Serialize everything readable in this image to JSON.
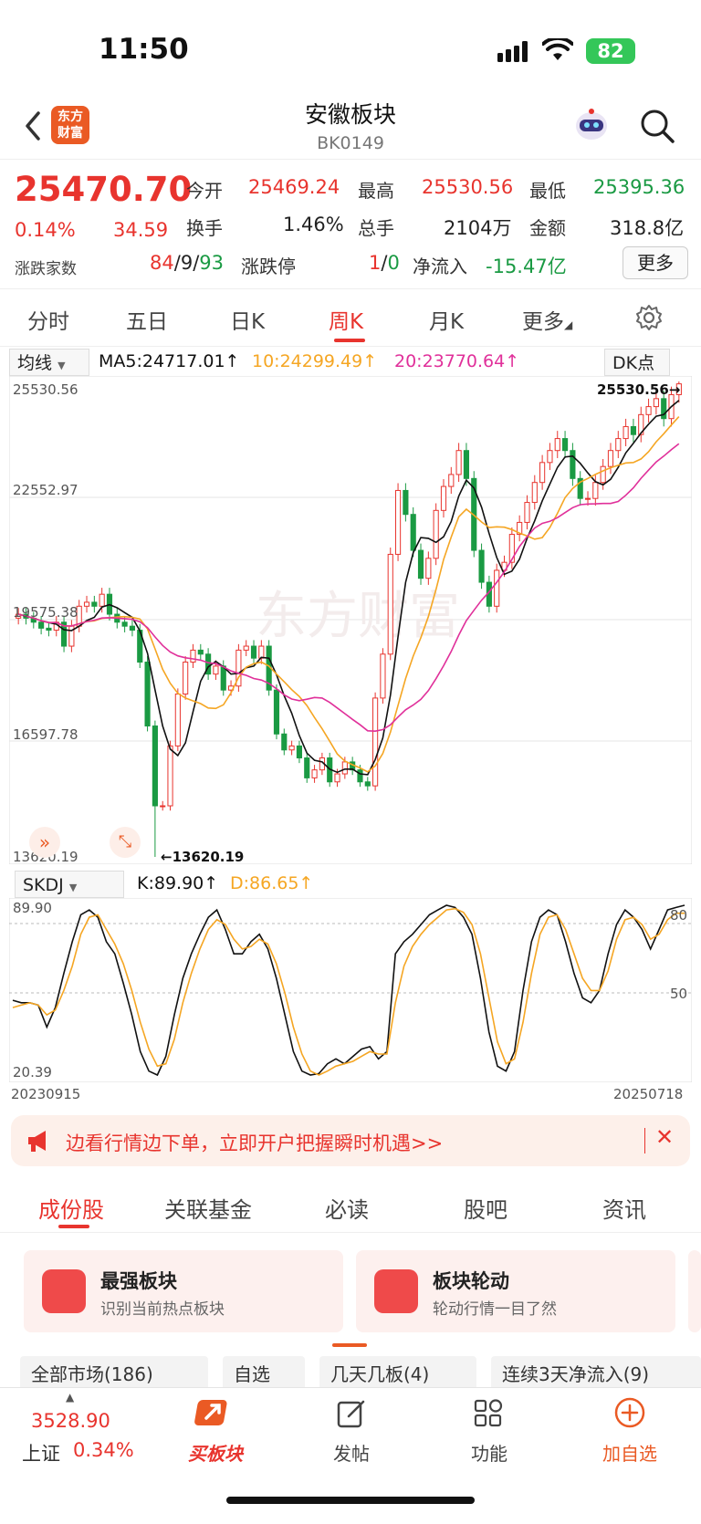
{
  "status_bar": {
    "time": "11:50",
    "battery": "82"
  },
  "header": {
    "title": "安徽板块",
    "code": "BK0149",
    "logo_text_1": "东方",
    "logo_text_2": "财富"
  },
  "quote": {
    "price": "25470.70",
    "change_pct": "0.14%",
    "change": "34.59",
    "open_label": "今开",
    "open": "25469.24",
    "high_label": "最高",
    "high": "25530.56",
    "low_label": "最低",
    "low": "25395.36",
    "turnover_label": "换手",
    "turnover": "1.46%",
    "volume_label": "总手",
    "volume": "2104万",
    "amount_label": "金额",
    "amount": "318.8亿",
    "breadth_label": "涨跌家数",
    "up": "84",
    "flat": "9",
    "down": "93",
    "limit_label": "涨跌停",
    "limit_up": "1",
    "limit_down": "0",
    "netflow_label": "净流入",
    "netflow": "-15.47亿",
    "more_label": "更多",
    "sep": "/"
  },
  "period_tabs": [
    "分时",
    "五日",
    "日K",
    "周K",
    "月K",
    "更多"
  ],
  "active_tab": "周K",
  "ma_bar": {
    "select": "均线",
    "ma5": "MA5:24717.01↑",
    "ma10": "10:24299.49↑",
    "ma20": "20:23770.64↑",
    "dk": "DK点"
  },
  "price_axis": {
    "top": "25530.56",
    "mid1": "22552.97",
    "mid2": "19575.38",
    "mid3": "16597.78",
    "bottom": "13620.19",
    "max_label": "25530.56→",
    "min_label": "←13620.19"
  },
  "watermark": "东方财富",
  "indicator_bar": {
    "select": "SKDJ",
    "k": "K:89.90↑",
    "d": "D:86.65↑"
  },
  "indicator_axis": {
    "top": "89.90",
    "bottom": "20.39",
    "l80": "80",
    "l50": "50"
  },
  "date_axis": {
    "start": "20230915",
    "end": "20250718"
  },
  "colors": {
    "up": "#e8342e",
    "down": "#1a9a43",
    "ma5": "#111111",
    "ma10": "#f5a623",
    "ma20": "#e0309a",
    "accent": "#ea5a24"
  },
  "chart_data": {
    "type": "candlestick",
    "title": "",
    "period": "weekly",
    "ylim": [
      13620.19,
      25530.56
    ],
    "max_high": 25530.56,
    "min_low": 13620.19,
    "closes": [
      19700,
      19600,
      19500,
      19350,
      19300,
      19500,
      18900,
      19400,
      19900,
      20000,
      19900,
      20200,
      19700,
      19500,
      19400,
      19300,
      18500,
      16900,
      14900,
      14900,
      16400,
      17700,
      18500,
      18800,
      18700,
      18200,
      18400,
      17800,
      17900,
      18800,
      18900,
      18600,
      18900,
      17800,
      16700,
      16300,
      16400,
      16100,
      15600,
      15800,
      16100,
      15500,
      15700,
      16000,
      15800,
      15500,
      15400,
      17600,
      18700,
      21200,
      22800,
      22200,
      21300,
      20600,
      21100,
      22300,
      22900,
      23200,
      23800,
      23100,
      21300,
      20500,
      19900,
      20800,
      21000,
      21700,
      22000,
      22500,
      23000,
      23500,
      23800,
      24100,
      23800,
      23100,
      22600,
      22600,
      23000,
      23400,
      23800,
      24100,
      24400,
      24200,
      24700,
      24900,
      25100,
      24600,
      25200,
      25470.7
    ],
    "ma_lines": [
      "MA5",
      "MA10",
      "MA20"
    ],
    "indicator": {
      "type": "SKDJ",
      "ylim": [
        20.39,
        89.9
      ],
      "K": [
        51,
        50,
        50,
        49,
        40,
        48,
        62,
        75,
        86,
        88,
        85,
        75,
        70,
        58,
        45,
        30,
        22,
        20,
        28,
        45,
        60,
        70,
        78,
        85,
        88,
        80,
        70,
        70,
        75,
        78,
        72,
        60,
        45,
        30,
        22,
        20,
        21,
        25,
        27,
        25,
        28,
        31,
        32,
        27,
        30,
        70,
        75,
        78,
        82,
        86,
        88,
        90,
        89,
        85,
        78,
        60,
        38,
        24,
        22,
        30,
        55,
        75,
        85,
        88,
        86,
        75,
        62,
        52,
        50,
        55,
        70,
        82,
        88,
        85,
        80,
        72,
        80,
        88,
        89,
        89.9
      ],
      "D": [
        48,
        49,
        50,
        49,
        45,
        47,
        55,
        65,
        78,
        85,
        86,
        80,
        74,
        66,
        55,
        42,
        31,
        24,
        25,
        35,
        50,
        62,
        72,
        80,
        84,
        82,
        76,
        72,
        73,
        76,
        74,
        66,
        54,
        40,
        29,
        22,
        20,
        22,
        24,
        25,
        26,
        28,
        30,
        29,
        29,
        50,
        65,
        73,
        78,
        82,
        85,
        88,
        88.5,
        87,
        82,
        70,
        52,
        34,
        25,
        27,
        42,
        62,
        78,
        85,
        86,
        80,
        70,
        60,
        55,
        55,
        63,
        76,
        84,
        85,
        82,
        76,
        78,
        84,
        86.65,
        86.65
      ]
    }
  },
  "banner": {
    "text": "边看行情边下单，立即开户把握瞬时机遇>>"
  },
  "content_tabs": [
    "成份股",
    "关联基金",
    "必读",
    "股吧",
    "资讯"
  ],
  "cards": [
    {
      "title": "最强板块",
      "sub": "识别当前热点板块"
    },
    {
      "title": "板块轮动",
      "sub": "轮动行情一目了然"
    }
  ],
  "filters": [
    "全部市场(186)",
    "自选",
    "几天几板(4)",
    "连续3天净流入(9)"
  ],
  "bottom_bar": {
    "index_value": "3528.90",
    "index_name": "上证",
    "index_pct": "0.34%",
    "buy_label": "买板块",
    "post_label": "发帖",
    "func_label": "功能",
    "add_label": "加自选"
  }
}
